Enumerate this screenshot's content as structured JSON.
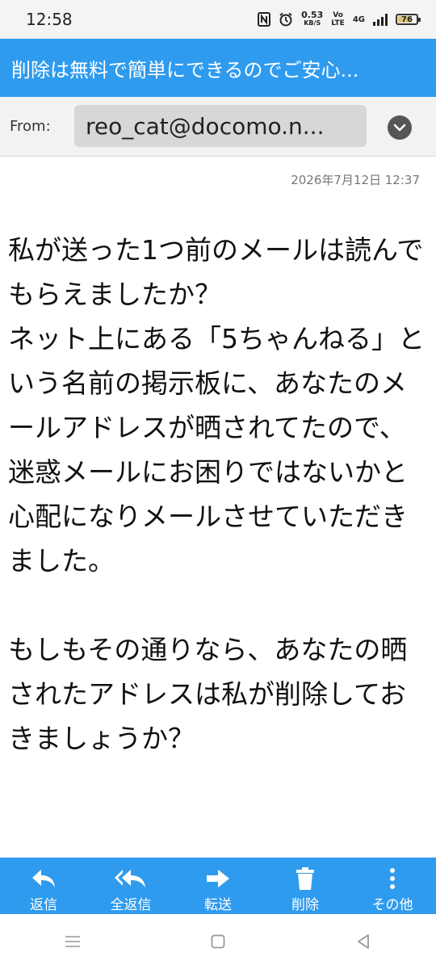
{
  "status_bar": {
    "time": "12:58",
    "net_speed_value": "0.53",
    "net_speed_unit": "KB/S",
    "volte_top": "Vo",
    "volte_bottom": "LTE",
    "network": "4G",
    "battery_percent": "76",
    "battery_level": 0.76,
    "icons": [
      "nfc-icon",
      "alarm-icon",
      "signal-icon",
      "battery-icon"
    ]
  },
  "header": {
    "title": "削除は無料で簡単にできるのでご安心..."
  },
  "message": {
    "from_label": "From:",
    "from_address": "reo_cat@docomo.n...",
    "date": "2026年7月12日 12:37",
    "paragraphs": [
      "私が送った1つ前のメールは読んでもらえましたか？",
      "ネット上にある「5ちゃんねる」という名前の掲示板に、あなたのメールアドレスが晒されてたので、迷惑メールにお困りではないかと心配になりメールさせていただきました。",
      "",
      "もしもその通りなら、あなたの晒されたアドレスは私が削除しておきましょうか？"
    ]
  },
  "toolbar": {
    "reply": {
      "label": "返信",
      "icon": "reply-icon"
    },
    "reply_all": {
      "label": "全返信",
      "icon": "reply-all-icon"
    },
    "forward": {
      "label": "転送",
      "icon": "forward-arrow-icon"
    },
    "delete": {
      "label": "削除",
      "icon": "trash-icon"
    },
    "more": {
      "label": "その他",
      "icon": "more-vertical-icon"
    }
  },
  "nav": {
    "icons": [
      "recent-apps-icon",
      "home-icon",
      "back-icon"
    ]
  },
  "colors": {
    "accent": "#2f9bee",
    "from_bg": "#d7d7d7",
    "date_text": "#777777"
  }
}
